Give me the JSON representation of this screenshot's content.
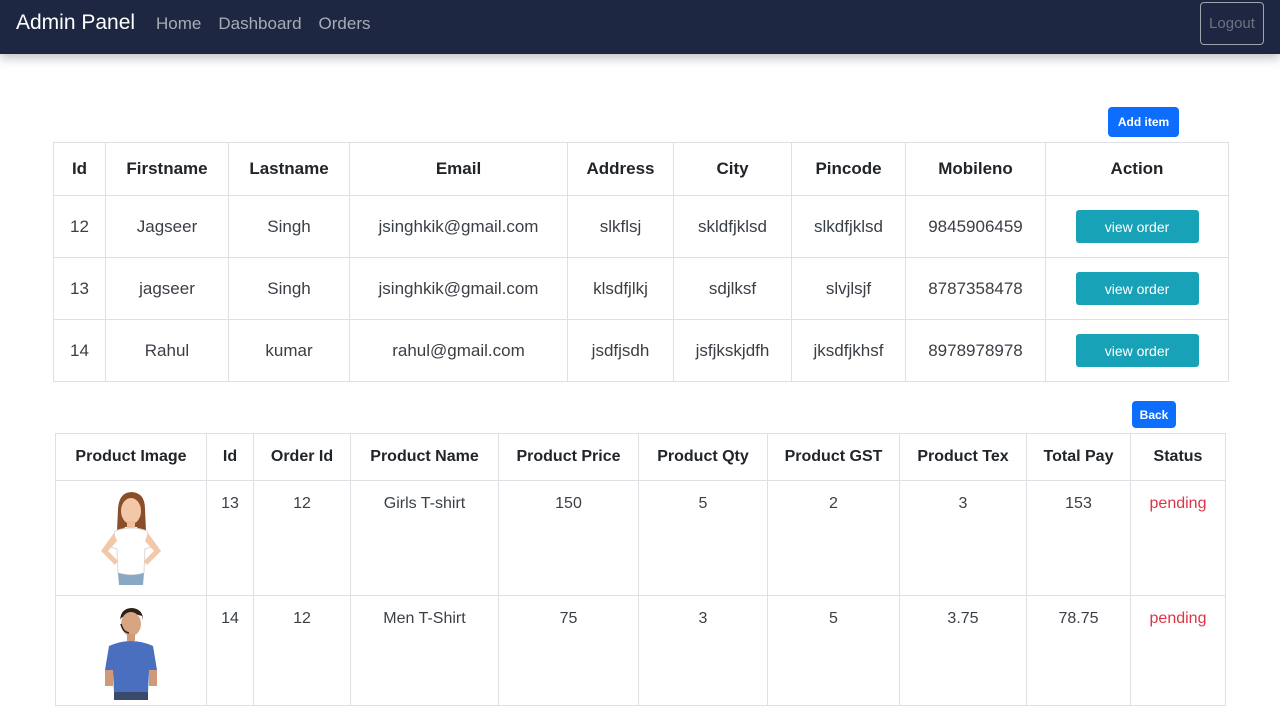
{
  "navbar": {
    "brand": "Admin Panel",
    "links": [
      "Home",
      "Dashboard",
      "Orders"
    ],
    "logout": "Logout"
  },
  "buttons": {
    "add_item": "Add item",
    "back": "Back"
  },
  "users_table": {
    "headers": [
      "Id",
      "Firstname",
      "Lastname",
      "Email",
      "Address",
      "City",
      "Pincode",
      "Mobileno",
      "Action"
    ],
    "rows": [
      {
        "id": "12",
        "firstname": "Jagseer",
        "lastname": "Singh",
        "email": "jsinghkik@gmail.com",
        "address": "slkflsj",
        "city": "skldfjklsd",
        "pincode": "slkdfjklsd",
        "mobileno": "9845906459",
        "action": "view order"
      },
      {
        "id": "13",
        "firstname": "jagseer",
        "lastname": "Singh",
        "email": "jsinghkik@gmail.com",
        "address": "klsdfjlkj",
        "city": "sdjlksf",
        "pincode": "slvjlsjf",
        "mobileno": "8787358478",
        "action": "view order"
      },
      {
        "id": "14",
        "firstname": "Rahul",
        "lastname": "kumar",
        "email": "rahul@gmail.com",
        "address": "jsdfjsdh",
        "city": "jsfjkskjdfh",
        "pincode": "jksdfjkhsf",
        "mobileno": "8978978978",
        "action": "view order"
      }
    ]
  },
  "orders_table": {
    "headers": [
      "Product Image",
      "Id",
      "Order Id",
      "Product Name",
      "Product Price",
      "Product Qty",
      "Product GST",
      "Product Tex",
      "Total Pay",
      "Status"
    ],
    "rows": [
      {
        "image": "girl-tshirt-photo",
        "id": "13",
        "order_id": "12",
        "name": "Girls T-shirt",
        "price": "150",
        "qty": "5",
        "gst": "2",
        "tex": "3",
        "total": "153",
        "status": "pending"
      },
      {
        "image": "men-tshirt-photo",
        "id": "14",
        "order_id": "12",
        "name": "Men T-Shirt",
        "price": "75",
        "qty": "3",
        "gst": "5",
        "tex": "3.75",
        "total": "78.75",
        "status": "pending"
      }
    ]
  },
  "colors": {
    "navbar": "#1d2742",
    "primary": "#0d6efd",
    "info": "#17a2b8",
    "danger": "#dc3545"
  }
}
